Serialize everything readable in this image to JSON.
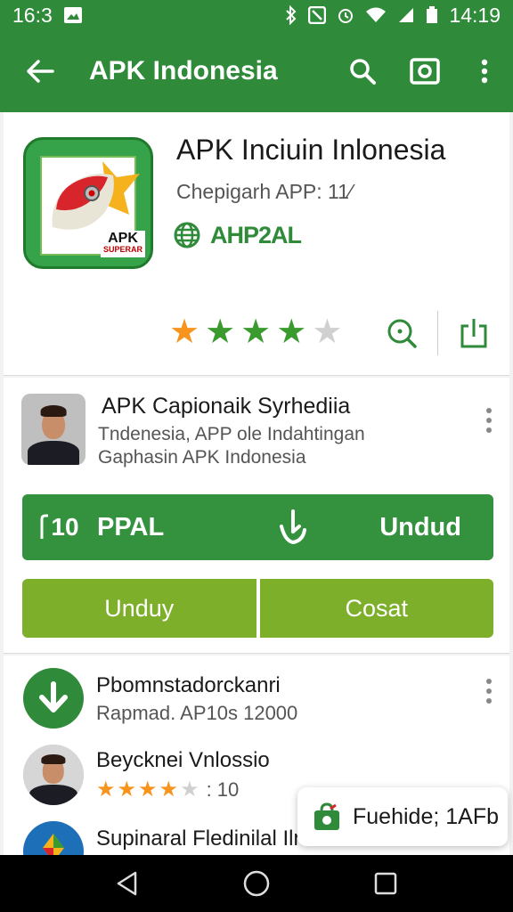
{
  "status_bar": {
    "time_left": "16:3",
    "time_right": "14:19"
  },
  "app_bar": {
    "title": "APK Indonesia"
  },
  "app": {
    "name": "APK Inciuin Inlonesia",
    "subtitle": "Chepigarh APP: 11⁄",
    "developer": "AHP2AL",
    "icon_badge_top": "APK",
    "icon_badge_bottom": "SUPERAR",
    "rating": 4,
    "rating_max": 5
  },
  "publisher": {
    "title": "APK Capionaik Syrhediia",
    "line1": "Tndenesia, APP ole Indahtingan",
    "line2": "Gaphasin APK Indonesia"
  },
  "download_bar": {
    "left_icon_text": "10",
    "left_label": "PPAL",
    "right_label": "Undud"
  },
  "buttons": {
    "left": "Unduy",
    "right": "Cosat"
  },
  "list": [
    {
      "title": "Pbomnstadorckanri",
      "sub": "Rapmad. AP10s 12000"
    },
    {
      "title": "Beycknei Vnlossio",
      "rating": 4,
      "rating_text": ": 10"
    },
    {
      "title": "Supinaral Fledinilal Ilna"
    }
  ],
  "snackbar": {
    "text": "Fuehide; 1AFb"
  },
  "colors": {
    "primary": "#2f8a3a",
    "olive": "#7daf2a",
    "star_orange": "#f7941d",
    "star_green": "#3a9a2e"
  }
}
